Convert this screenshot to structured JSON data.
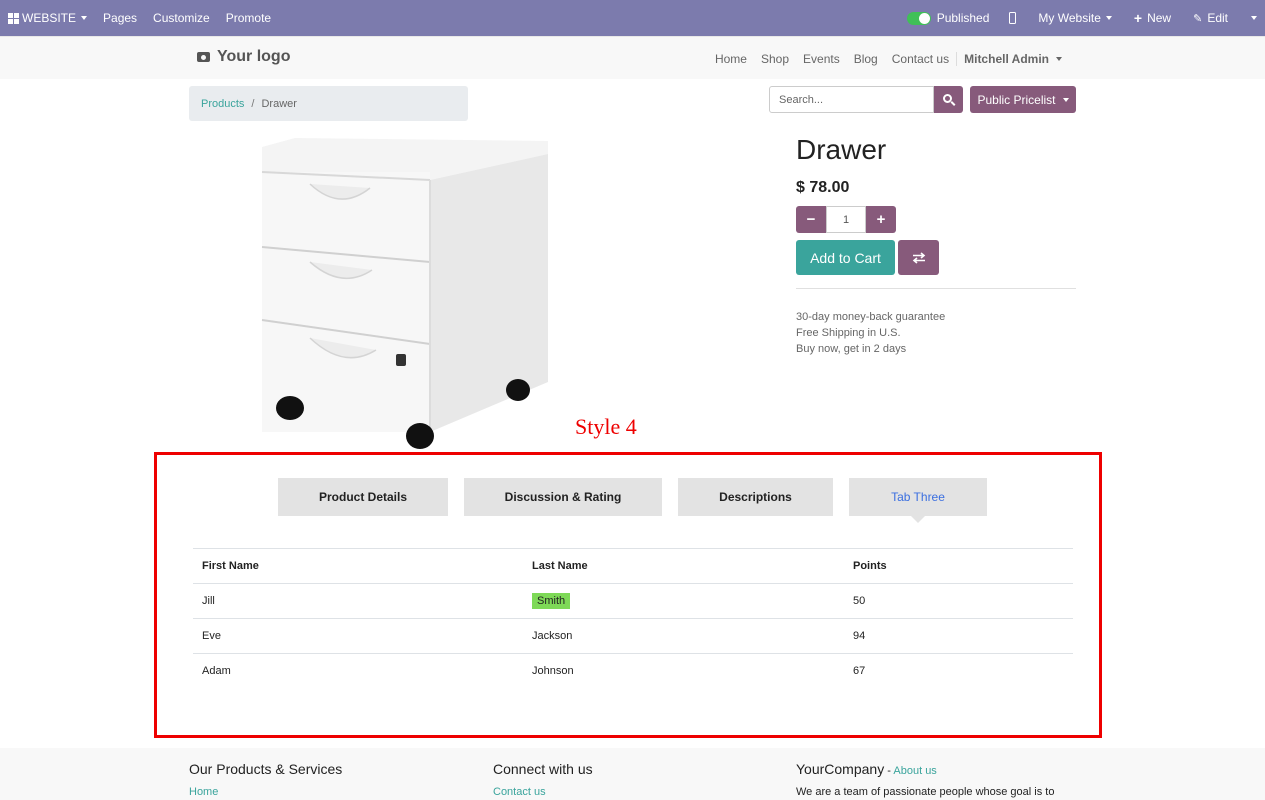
{
  "adminbar": {
    "website_label": "WEBSITE",
    "pages_label": "Pages",
    "customize_label": "Customize",
    "promote_label": "Promote",
    "published_label": "Published",
    "my_website_label": "My Website",
    "new_label": "New",
    "edit_label": "Edit"
  },
  "header": {
    "logo_text": "Your logo",
    "nav": [
      "Home",
      "Shop",
      "Events",
      "Blog",
      "Contact us"
    ],
    "user_name": "Mitchell Admin"
  },
  "breadcrumb": {
    "parent": "Products",
    "separator": "/",
    "current": "Drawer"
  },
  "search": {
    "placeholder": "Search..."
  },
  "pricelist": {
    "label": "Public Pricelist"
  },
  "product": {
    "name": "Drawer",
    "price": "$ 78.00",
    "quantity": "1",
    "minus_label": "−",
    "plus_label": "+",
    "add_to_cart_label": "Add to Cart",
    "guarantee": [
      "30-day money-back guarantee",
      "Free Shipping in U.S.",
      "Buy now, get in 2 days"
    ]
  },
  "style_label": "Style 4",
  "tabs": [
    {
      "label": "Product Details",
      "active": false
    },
    {
      "label": "Discussion & Rating",
      "active": false
    },
    {
      "label": "Descriptions",
      "active": false
    },
    {
      "label": "Tab Three",
      "active": true
    }
  ],
  "table": {
    "headers": [
      "First Name",
      "Last Name",
      "Points"
    ],
    "rows": [
      [
        "Jill",
        "Smith",
        "50"
      ],
      [
        "Eve",
        "Jackson",
        "94"
      ],
      [
        "Adam",
        "Johnson",
        "67"
      ]
    ],
    "highlight_color": "#7ed957"
  },
  "footer": {
    "col1_title": "Our Products & Services",
    "col1_link": "Home",
    "col2_title": "Connect with us",
    "col2_link": "Contact us",
    "col3_title": "YourCompany",
    "col3_separator": " - ",
    "col3_link": "About us",
    "col3_text": "We are a team of passionate people whose goal is to"
  },
  "colors": {
    "adminbar": "#7c7bad",
    "primary": "#875a7b",
    "accent": "#3aa49c",
    "frame": "#ee0000",
    "active_tab_text": "#3b6fe0"
  }
}
